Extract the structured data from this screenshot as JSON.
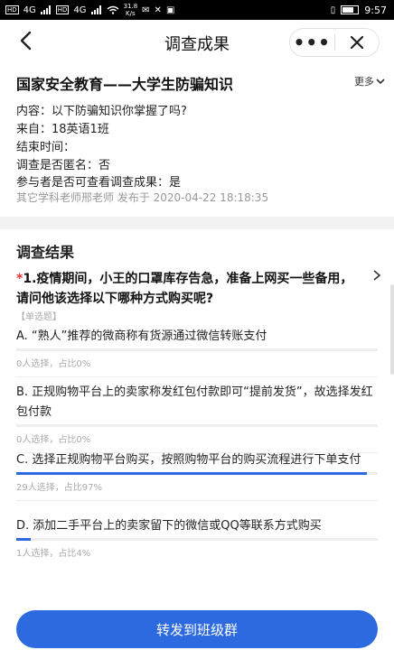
{
  "status_bar": {
    "left_tags": [
      "HD",
      "HD"
    ],
    "signal1": "4G",
    "signal2": "4G",
    "speed": "31.8",
    "speed_unit": "K/s",
    "time": "9:57"
  },
  "nav": {
    "title": "调查成果"
  },
  "survey": {
    "title": "国家安全教育——大学生防骗知识",
    "more": "更多",
    "content_line": "内容：以下防骗知识你掌握了吗?",
    "from_line": "来自：18英语1班",
    "end_line": "结束时间：",
    "anon_line": "调查是否匿名：否",
    "visible_line": "参与者是否可查看调查成果：是",
    "meta": "其它学科老师邢老师 发布于 2020-04-22 18:18:35"
  },
  "results": {
    "title": "调查结果",
    "question_mark": "*",
    "question": "1.疫情期间，小王的口罩库存告急，准备上网买一些备用，请问他该选择以下哪种方式购买呢?",
    "type": "【单选题】",
    "options": [
      {
        "text": "A. “熟人”推荐的微商称有货源通过微信转账支付",
        "stat": "0人选择，占比0%",
        "percent": 0
      },
      {
        "text": "B. 正规购物平台上的卖家称发红包付款即可“提前发货”，故选择发红包付款",
        "stat": "0人选择，占比0%",
        "percent": 0
      },
      {
        "text": "C. 选择正规购物平台购买，按照购物平台的购买流程进行下单支付",
        "stat": "29人选择，占比97%",
        "percent": 97
      },
      {
        "text": "D. 添加二手平台上的卖家留下的微信或QQ等联系方式购买",
        "stat": "1人选择，占比4%",
        "percent": 4
      }
    ]
  },
  "share_button": "转发到班级群",
  "colors": {
    "accent": "#2d6ae0",
    "required": "#e33333"
  }
}
